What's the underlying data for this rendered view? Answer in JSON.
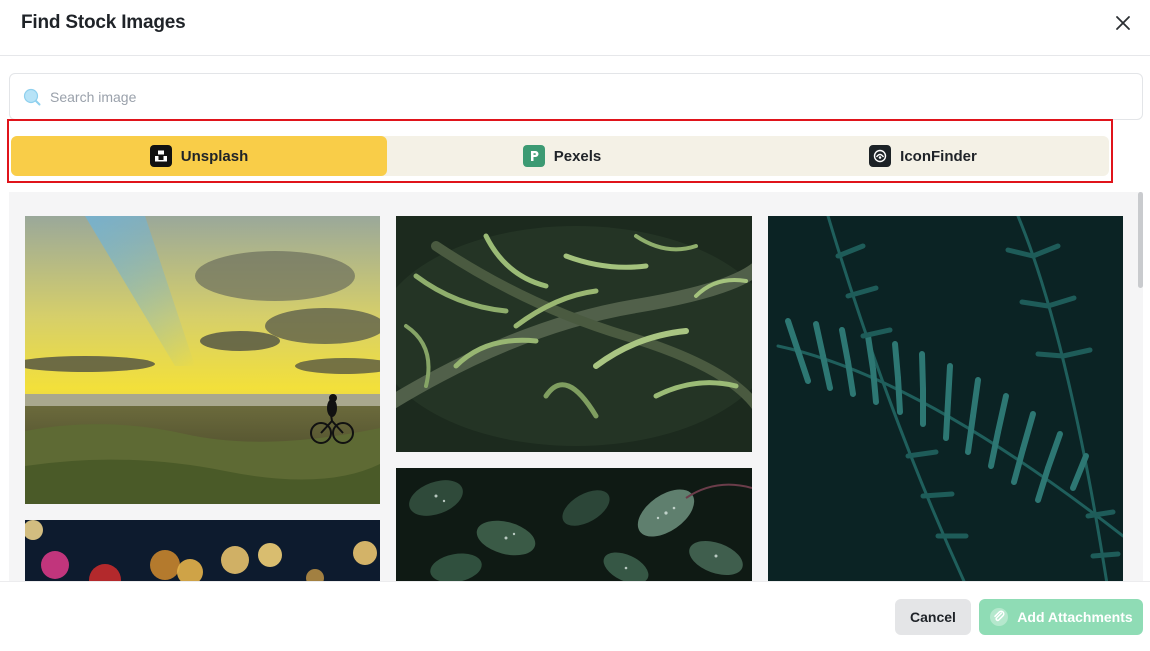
{
  "dialog": {
    "title": "Find Stock Images",
    "close_icon": "close-icon"
  },
  "search": {
    "placeholder": "Search image",
    "value": "",
    "icon": "search-icon"
  },
  "tabs": [
    {
      "label": "Unsplash",
      "icon": "unsplash-logo-icon",
      "active": true
    },
    {
      "label": "Pexels",
      "icon": "pexels-logo-icon",
      "active": false
    },
    {
      "label": "IconFinder",
      "icon": "iconfinder-logo-icon",
      "active": false
    }
  ],
  "gallery": {
    "images": [
      {
        "subject": "sunset-beach-cyclist"
      },
      {
        "subject": "green-succulent-branches"
      },
      {
        "subject": "teal-fern-leaves"
      },
      {
        "subject": "bokeh-lights"
      },
      {
        "subject": "dew-covered-leaves"
      }
    ]
  },
  "footer": {
    "cancel_label": "Cancel",
    "add_label": "Add Attachments",
    "add_icon": "paperclip-icon"
  },
  "colors": {
    "active_tab": "#f9cd48",
    "tab_bar": "#f4f1e6",
    "highlight_border": "#e0141b",
    "add_button": "#8fdcb5",
    "cancel_button": "#e4e5e7",
    "pexels_brand": "#3c9a73"
  }
}
